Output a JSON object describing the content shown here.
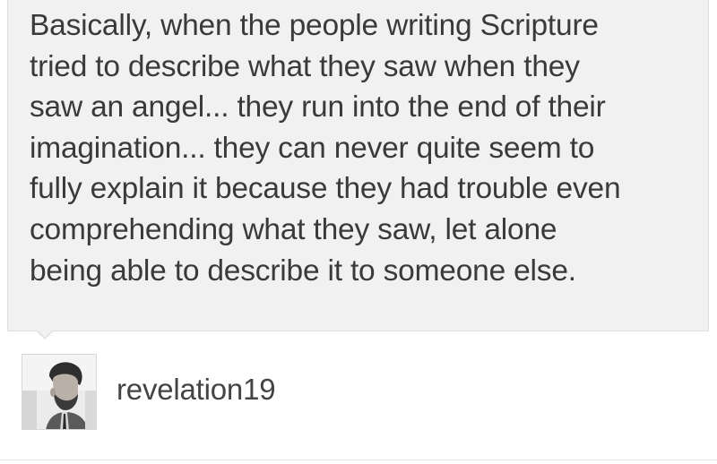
{
  "quote": {
    "lines": [
      "Basically, when the people writing Scripture",
      "tried to describe what they saw when they",
      "saw an angel... they run into the end of their",
      "imagination... they can never quite seem to",
      "fully explain it because they had trouble even",
      "comprehending what they saw, let alone",
      "being able to describe it to someone else."
    ]
  },
  "author": {
    "username": "revelation19",
    "avatar_icon": "user-avatar-photo"
  },
  "colors": {
    "bubble_background": "#f1f1f1",
    "text": "#3a3a3a"
  }
}
